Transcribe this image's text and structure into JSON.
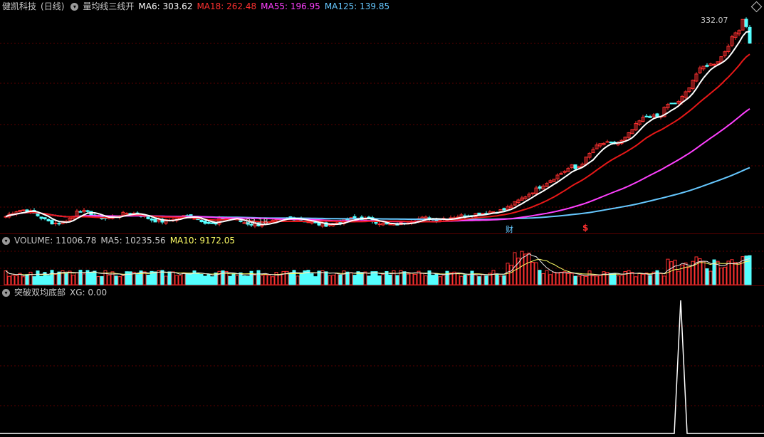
{
  "stock": {
    "name": "健凯科技",
    "period": "(日线)"
  },
  "main_header": {
    "indicator": "量均线三线开",
    "items": [
      {
        "label": "MA6: 303.62",
        "color": "#ffffff"
      },
      {
        "label": "MA18: 262.48",
        "color": "#ff3030"
      },
      {
        "label": "MA55: 196.95",
        "color": "#ff40ff"
      },
      {
        "label": "MA125: 139.85",
        "color": "#66c8ff"
      }
    ]
  },
  "volume_header": {
    "items": [
      {
        "label": "VOLUME: 11006.78",
        "color": "#c8c8c8"
      },
      {
        "label": "MA5: 10235.56",
        "color": "#c8c8c8"
      },
      {
        "label": "MA10: 9172.05",
        "color": "#ffff66"
      }
    ]
  },
  "signal_header": {
    "items": [
      {
        "label": "突破双均底部",
        "color": "#c8c8c8"
      },
      {
        "label": "XG: 0.00",
        "color": "#c8c8c8"
      }
    ]
  },
  "annotations": {
    "high_label": "332.07",
    "low_label": "83.18",
    "event_cai": "财",
    "event_dollar": "$"
  },
  "colors": {
    "up": "#ff3030",
    "down": "#54ffff",
    "ma6": "#ffffff",
    "ma18": "#e81818",
    "ma55": "#ff40ff",
    "ma125": "#66c8ff",
    "grid": "#5a0000",
    "vol_ma5": "#e8e8e8",
    "vol_ma10": "#ffff66"
  },
  "chart_data": [
    {
      "type": "candlestick",
      "title": "健凯科技 (日线) 量均线三线开",
      "series": [
        {
          "name": "MA6",
          "last": 303.62
        },
        {
          "name": "MA18",
          "last": 262.48
        },
        {
          "name": "MA55",
          "last": 196.95
        },
        {
          "name": "MA125",
          "last": 139.85
        }
      ],
      "high": 332.07,
      "low": 83.18,
      "ylim": [
        80,
        340
      ]
    },
    {
      "type": "bar",
      "title": "VOLUME",
      "series": [
        {
          "name": "VOLUME",
          "last": 11006.78
        },
        {
          "name": "MA5",
          "last": 10235.56
        },
        {
          "name": "MA10",
          "last": 9172.05
        }
      ]
    },
    {
      "type": "line",
      "title": "突破双均底部",
      "series": [
        {
          "name": "XG",
          "last": 0.0
        }
      ]
    }
  ]
}
